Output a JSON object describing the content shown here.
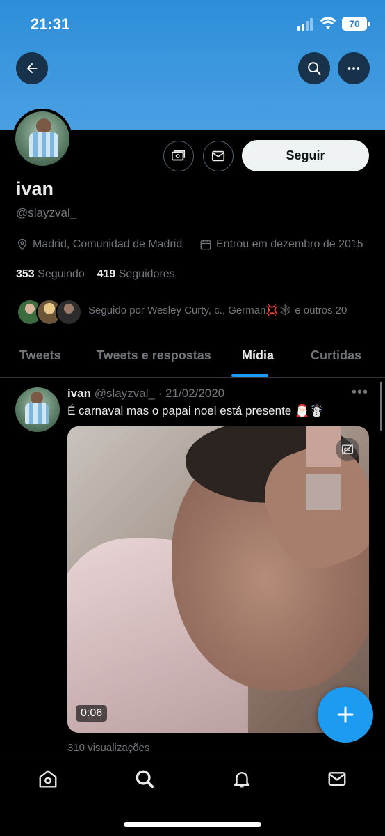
{
  "status_bar": {
    "time": "21:31",
    "battery": "70"
  },
  "header": {
    "back_icon": "arrow-left-icon",
    "search_icon": "search-icon",
    "more_icon": "more-horizontal-icon"
  },
  "profile": {
    "name": "ivan",
    "handle": "@slayzval_",
    "location": "Madrid, Comunidad de Madrid",
    "joined": "Entrou em dezembro de 2015",
    "following_count": "353",
    "following_label": "Seguindo",
    "followers_count": "419",
    "followers_label": "Seguidores",
    "followed_by": "Seguido por Wesley Curty, c., German💢🕸 e outros 20",
    "follow_button": "Seguir",
    "banner_color": "#3b97df",
    "accent_color": "#1d9bf0"
  },
  "tabs": [
    {
      "label": "Tweets",
      "active": false
    },
    {
      "label": "Tweets e respostas",
      "active": false
    },
    {
      "label": "Mídia",
      "active": true
    },
    {
      "label": "Curtidas",
      "active": false
    }
  ],
  "tweet": {
    "author": "ivan",
    "handle_date": "@slayzval_ · 21/02/2020",
    "text": "É carnaval mas o papai noel está presente 🎅🏻☃️",
    "duration": "0:06",
    "views": "310 visualizações"
  },
  "bottom_nav": [
    {
      "icon": "home-icon"
    },
    {
      "icon": "search-icon"
    },
    {
      "icon": "bell-icon"
    },
    {
      "icon": "mail-icon"
    }
  ]
}
